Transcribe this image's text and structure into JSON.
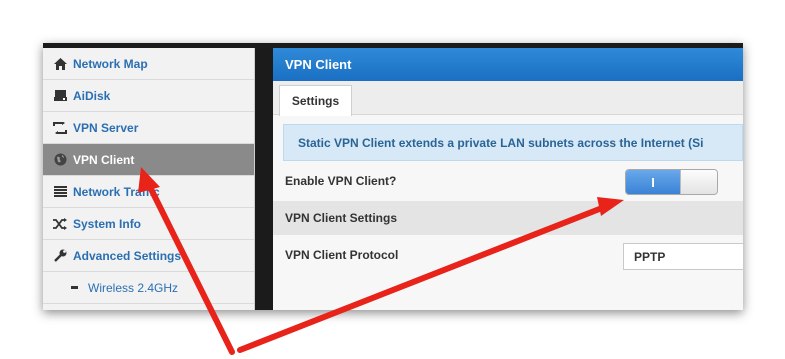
{
  "sidebar": {
    "items": [
      {
        "label": "Network Map",
        "icon": "home-icon"
      },
      {
        "label": "AiDisk",
        "icon": "disk-icon"
      },
      {
        "label": "VPN Server",
        "icon": "vpn-server-icon"
      },
      {
        "label": "VPN Client",
        "icon": "globe-icon",
        "active": true
      },
      {
        "label": "Network Traffic",
        "icon": "traffic-list-icon"
      },
      {
        "label": "System Info",
        "icon": "shuffle-icon"
      },
      {
        "label": "Advanced Settings",
        "icon": "wrench-icon"
      },
      {
        "label": "Wireless 2.4GHz",
        "icon": "dash-icon",
        "sub": true
      }
    ]
  },
  "main": {
    "title": "VPN Client",
    "tabs": [
      {
        "label": "Settings"
      }
    ],
    "info_text": "Static VPN Client extends a private LAN subnets across the Internet (Si",
    "enable_label": "Enable VPN Client?",
    "enable_value": "I",
    "section_title": "VPN Client Settings",
    "protocol_label": "VPN Client Protocol",
    "protocol_value": "PPTP"
  },
  "colors": {
    "accent": "#1a6fc2",
    "arrow": "#e8231a",
    "active_item": "#8a8a8a"
  }
}
